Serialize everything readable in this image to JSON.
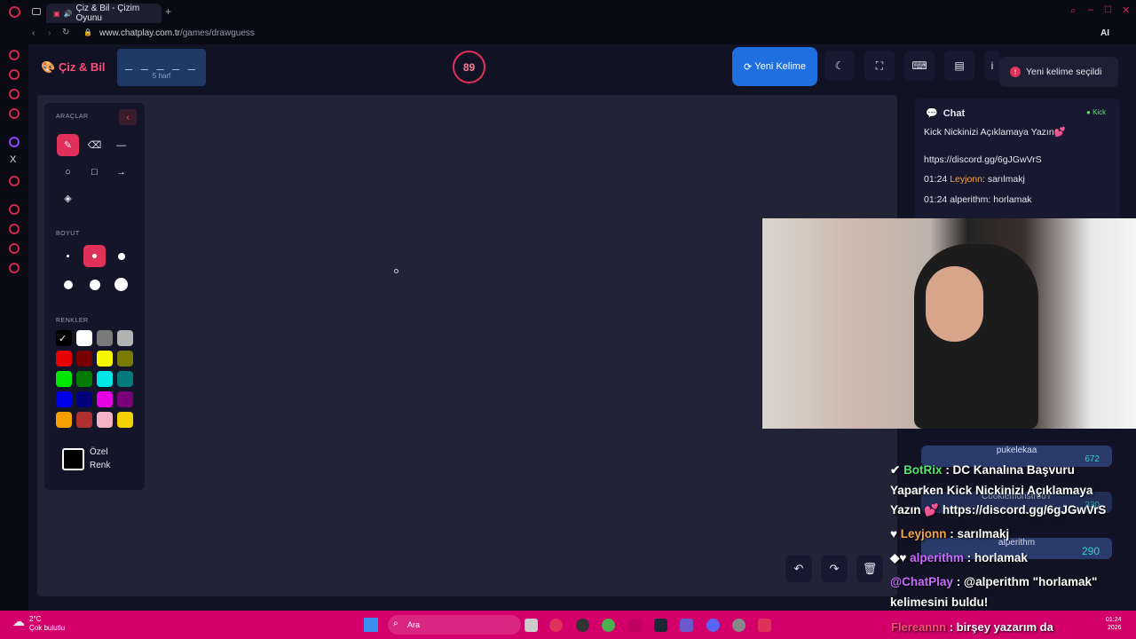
{
  "browser": {
    "tab_title": "Çiz & Bil - Çizim Oyunu",
    "url_host": "www.chatplay.com.tr",
    "url_path": "/games/drawguess",
    "ai_label": "AI"
  },
  "header": {
    "logo": "Çiz & Bil",
    "word": "_ _ _ _ _",
    "word_length": "5 harf",
    "timer": "89",
    "new_word": "Yeni Kelime"
  },
  "toast": {
    "text": "Yeni kelime seçildi"
  },
  "tools_panel": {
    "tools_title": "ARAÇLAR",
    "size_title": "BOYUT",
    "colors_title": "RENKLER",
    "custom_color": "Özel Renk",
    "colors": [
      "#000000",
      "#ffffff",
      "#7a7a7a",
      "#b3b3b3",
      "#e60000",
      "#7a0000",
      "#f5f500",
      "#7a7a00",
      "#00e600",
      "#007a00",
      "#00e6e6",
      "#007a7a",
      "#0000e6",
      "#00007a",
      "#e600e6",
      "#7a007a",
      "#f5a000",
      "#b03030",
      "#f5b3c8",
      "#f5d000"
    ]
  },
  "chat": {
    "title": "Chat",
    "platform": "Kick",
    "messages": [
      {
        "text": "Kick Nickinizi Açıklamaya Yazın💕"
      },
      {
        "text": "https://discord.gg/6gJGwVrS"
      },
      {
        "time": "01:24",
        "user": "Leyjonn",
        "text": ": sarılmakj"
      },
      {
        "time": "01:24",
        "user": "alperithm",
        "text": ": horlamak"
      }
    ]
  },
  "leaderboard": [
    {
      "name": "pukelekaa",
      "score": "672"
    },
    {
      "name": "CookiemonstruoT",
      "score": "330"
    },
    {
      "name": "alperithm",
      "score": "290"
    }
  ],
  "overlay_chat": [
    {
      "user": "BotRix",
      "text": " : DC Kanalına Başvuru"
    },
    {
      "text": "Yaparken Kick Nickinizi Açıklamaya"
    },
    {
      "text": "Yazın 💕 https://discord.gg/6gJGwVrS"
    },
    {
      "user": "Leyjonn",
      "text": " : sarılmakj"
    },
    {
      "user": "alperithm",
      "text": " : horlamak"
    },
    {
      "user": "@ChatPlay",
      "text": " : @alperithm \"horlamak\""
    },
    {
      "text": "kelimesini buldu!"
    },
    {
      "user": "Flereannn",
      "text": " : birşey yazarım da"
    }
  ],
  "taskbar": {
    "temp": "2°C",
    "weather": "Çok bulutlu",
    "search": "Ara",
    "time": "01:24",
    "date": "2026"
  }
}
